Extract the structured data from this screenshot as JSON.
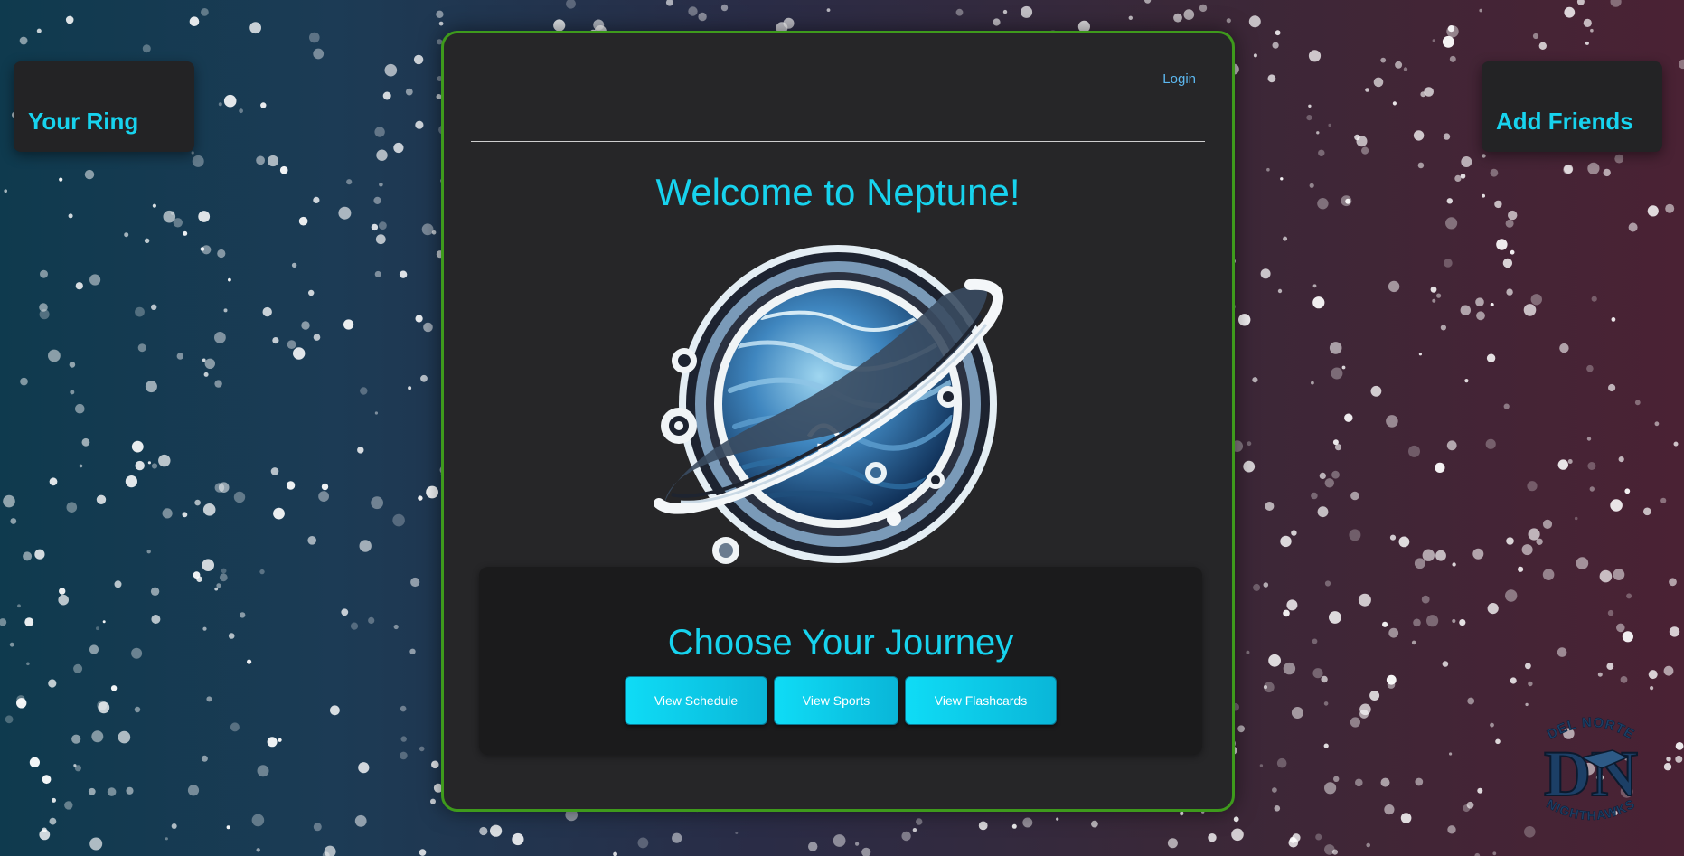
{
  "colors": {
    "accent": "#17d3ee",
    "main_border": "#3e9a1c",
    "panel_bg": "#262628",
    "login_link": "#5cb8f0"
  },
  "left_card": {
    "label": "Your Ring"
  },
  "right_card": {
    "label": "Add Friends"
  },
  "header": {
    "login_label": "Login"
  },
  "main": {
    "title": "Welcome to Neptune!",
    "logo_icon": "neptune-planet-logo-icon"
  },
  "journey": {
    "title": "Choose Your Journey",
    "buttons": [
      {
        "label": "View Schedule"
      },
      {
        "label": "View Sports"
      },
      {
        "label": "View Flashcards"
      }
    ]
  },
  "school_logo": {
    "icon": "del-norte-nighthawks-logo-icon",
    "top_text": "DEL NORTE",
    "bottom_text": "NIGHTHAWKS",
    "monogram": "DN"
  }
}
